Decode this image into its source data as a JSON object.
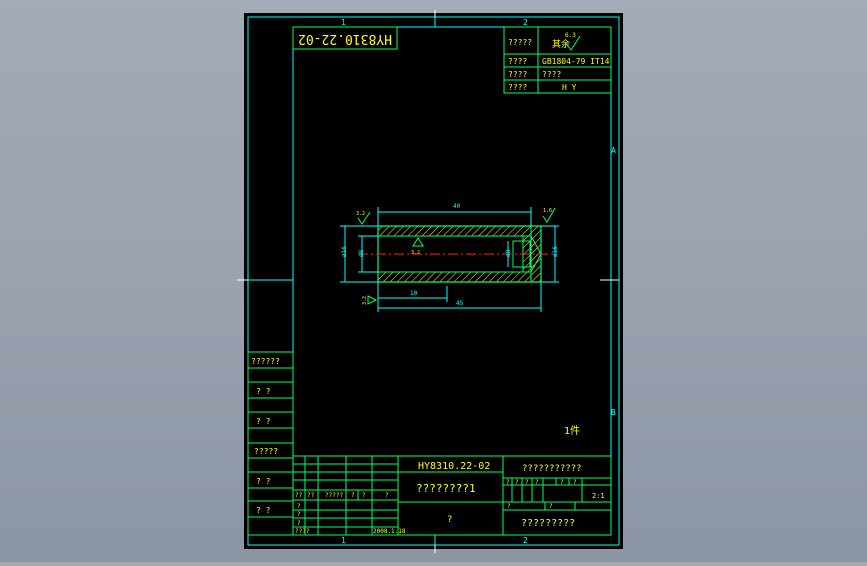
{
  "colors": {
    "background": "#9aa2b0",
    "paper": "#000000",
    "border": "#00ffff",
    "text": "#ffff00",
    "outline_green": "#00ff66",
    "dimension": "#00ffff",
    "hatch": "#ffff00",
    "centerline": "#ff2020",
    "zone_marks": "#ffffff"
  },
  "zone_markers": {
    "top_1": "1",
    "top_2": "2",
    "bottom_1": "1",
    "bottom_2": "2",
    "right_a": "A",
    "right_b": "B"
  },
  "mirrored_code": "HY8310.22-02",
  "spec_table": {
    "rows": [
      {
        "label": "?????",
        "value": "其余"
      },
      {
        "label": "????",
        "value": "GB1804-79  IT14"
      },
      {
        "label": "????",
        "value": "????"
      },
      {
        "label": "????",
        "value": "H Y"
      }
    ],
    "roughness_value": "6.3"
  },
  "dimensions": {
    "overall_length": "40",
    "bore_depth": "10",
    "total_length": "45",
    "outer_diameter": "ø16",
    "inner_diameter": "ø8",
    "small_diameter": "ø8",
    "right_diameter": "ø16",
    "roughness_left": "3.2",
    "roughness_right": "1.6",
    "roughness_inner": "3.2",
    "roughness_bottom": "3.2"
  },
  "quantity_note": "1件",
  "left_strip": [
    "??????",
    "?  ?",
    "?  ?",
    "?????",
    "?  ?",
    "?  ?"
  ],
  "title_block": {
    "drawing_number": "HY8310.22-02",
    "part_name": "????????1",
    "material": "?",
    "company": "???????????",
    "scale": "2:1",
    "sheet_title": "?????????",
    "date": "2008.1.18",
    "sign_labels": [
      "??",
      "??",
      "?????",
      "?",
      "?",
      "?"
    ],
    "row_labels": [
      "?",
      "?",
      "?",
      "????"
    ],
    "small_cells": [
      "?",
      "?",
      "?",
      "?",
      "?",
      "?",
      "?",
      "?"
    ]
  }
}
